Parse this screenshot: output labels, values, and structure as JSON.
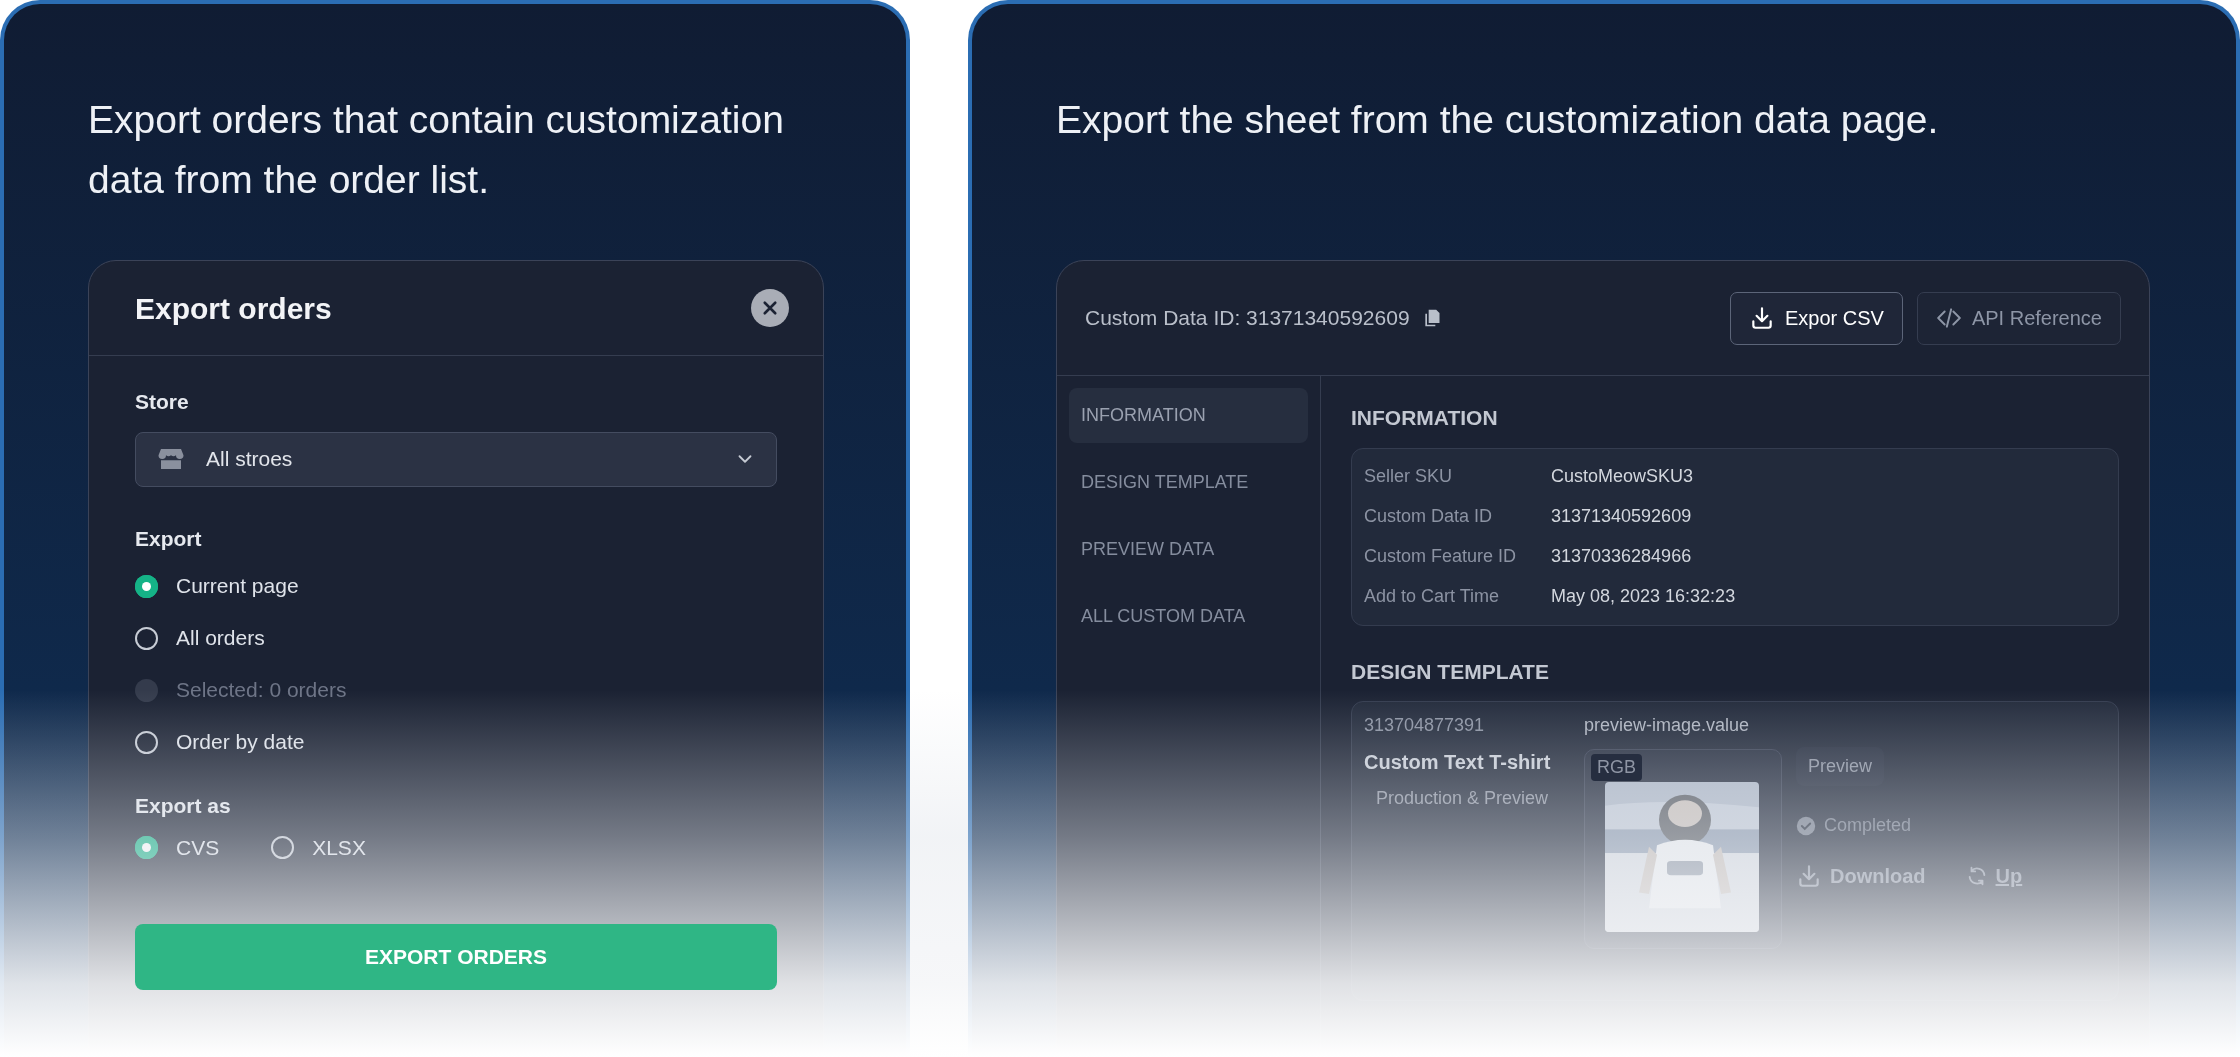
{
  "left_panel": {
    "heading": "Export orders that contain customization data from the order list.",
    "dialog": {
      "title": "Export orders",
      "store": {
        "label": "Store",
        "value": "All stroes"
      },
      "export": {
        "label": "Export",
        "options": [
          {
            "label": "Current page",
            "selected": true,
            "disabled": false
          },
          {
            "label": "All orders",
            "selected": false,
            "disabled": false
          },
          {
            "label": "Selected: 0 orders",
            "selected": false,
            "disabled": true
          },
          {
            "label": "Order by date",
            "selected": false,
            "disabled": false
          }
        ]
      },
      "export_as": {
        "label": "Export as",
        "options": [
          {
            "label": "CVS",
            "selected": true
          },
          {
            "label": "XLSX",
            "selected": false
          }
        ]
      },
      "submit": "EXPORT ORDERS"
    }
  },
  "right_panel": {
    "heading": "Export the sheet from the customization data page.",
    "card": {
      "custom_data_id": "Custom Data ID: 31371340592609",
      "buttons": [
        {
          "label": "Expor CSV",
          "kind": "download"
        },
        {
          "label": "API Reference",
          "kind": "code"
        }
      ],
      "sidebar": [
        {
          "label": "INFORMATION",
          "selected": true
        },
        {
          "label": "DESIGN TEMPLATE",
          "selected": false
        },
        {
          "label": "PREVIEW DATA",
          "selected": false
        },
        {
          "label": "ALL CUSTOM DATA",
          "selected": false
        }
      ],
      "information": {
        "title": "INFORMATION",
        "rows": [
          {
            "label": "Seller SKU",
            "value": "CustoMeowSKU3"
          },
          {
            "label": "Custom Data ID",
            "value": "31371340592609"
          },
          {
            "label": "Custom Feature ID",
            "value": "31370336284966"
          },
          {
            "label": "Add to Cart Time",
            "value": "May 08, 2023 16:32:23"
          }
        ]
      },
      "design_template": {
        "title": "DESIGN TEMPLATE",
        "id": "313704877391",
        "name": "Custom Text T-shirt",
        "subtitle": "Production & Preview",
        "field": "preview-image.value",
        "image_tag": "RGB",
        "preview_label": "Preview",
        "status": "Completed",
        "actions": [
          {
            "label": "Download",
            "kind": "download"
          },
          {
            "label": "Up",
            "kind": "upload"
          }
        ]
      }
    }
  }
}
